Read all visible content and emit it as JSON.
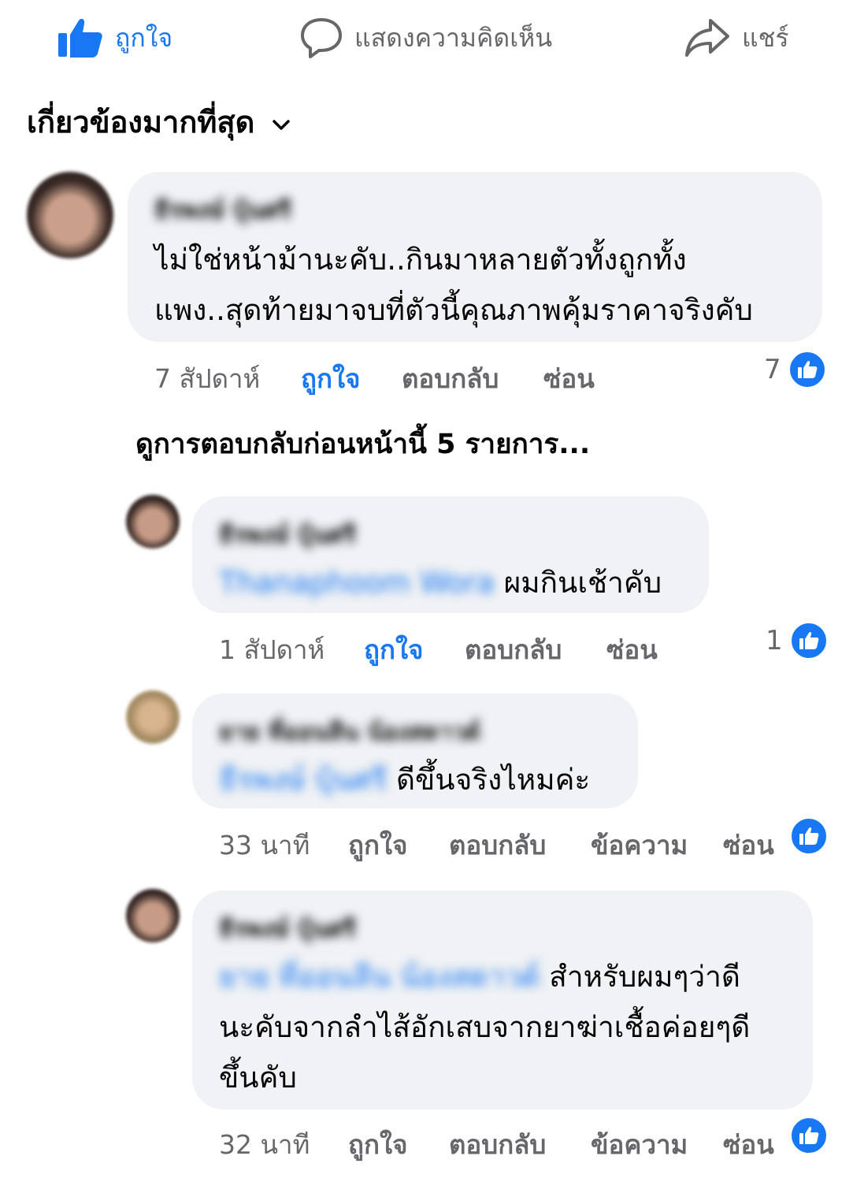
{
  "actions": {
    "like": "ถูกใจ",
    "comment": "แสดงความคิดเห็น",
    "share": "แชร์"
  },
  "sort_label": "เกี่ยวข้องมากที่สุด",
  "view_previous_replies": "ดูการตอบกลับก่อนหน้านี้ 5 รายการ...",
  "colors": {
    "accent": "#1877f2",
    "bubble": "#f0f2f5",
    "meta": "#65676b"
  },
  "comments": [
    {
      "author": "ธีรพงษ์ บุ้นศรี",
      "text_lines": [
        "ไม่ใช่หน้าม้านะคับ..กินมาหลายตัวทั้งถูกทั้ง",
        "แพง..สุดท้ายมาจบที่ตัวนี้คุณภาพคุ้มราคาจริงคับ"
      ],
      "time": "7 สัปดาห์",
      "like": "ถูกใจ",
      "reply": "ตอบกลับ",
      "hide": "ซ่อน",
      "like_count": "7"
    },
    {
      "author": "ธีรพงษ์ บุ้นศรี",
      "mention": "Thanaphoom Wora",
      "text": "ผมกินเช้าคับ",
      "time": "1 สัปดาห์",
      "like": "ถูกใจ",
      "reply": "ตอบกลับ",
      "hide": "ซ่อน",
      "like_count": "1"
    },
    {
      "author": "ยาย ที่ออนลีน น้องสดาวด์",
      "mention": "ธีรพงษ์ บุ้นศรี",
      "text": "ดีขึ้นจริงไหมค่ะ",
      "time": "33 นาที",
      "like": "ถูกใจ",
      "reply": "ตอบกลับ",
      "message": "ข้อความ",
      "hide": "ซ่อน"
    },
    {
      "author": "ธีรพงษ์ บุ้นศรี",
      "mention": "ยาย ที่ออนลีน น้องสดาวด์",
      "text_lines": [
        "สำหรับผมๆว่าดี",
        "นะคับจากลำไส้อักเสบจากยาฆ่าเชื้อค่อยๆดี",
        "ขึ้นคับ"
      ],
      "time": "32 นาที",
      "like": "ถูกใจ",
      "reply": "ตอบกลับ",
      "message": "ข้อความ",
      "hide": "ซ่อน"
    }
  ]
}
